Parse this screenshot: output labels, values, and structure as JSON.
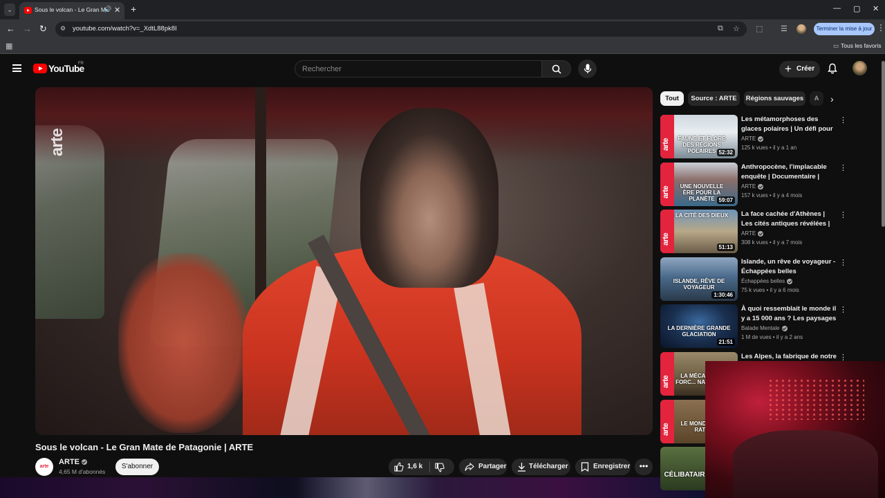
{
  "browser": {
    "tab_title": "Sous le volcan - Le Gran Ma",
    "url": "youtube.com/watch?v=_XdtL88pk8I",
    "update_button": "Terminer la mise à jour",
    "bookmarks_all": "Tous les favoris"
  },
  "header": {
    "logo_text": "YouTube",
    "country": "FR",
    "search_placeholder": "Rechercher",
    "create_label": "Créer"
  },
  "video": {
    "title": "Sous le volcan - Le Gran Mate de Patagonie | ARTE",
    "watermark": "arte",
    "channel": {
      "name": "ARTE",
      "avatar_text": "arte",
      "subscribers": "4,65 M d'abonnés",
      "subscribe_label": "S'abonner"
    },
    "actions": {
      "likes": "1,6 k",
      "share": "Partager",
      "download": "Télécharger",
      "save": "Enregistrer"
    }
  },
  "chips": [
    "Tout",
    "Source : ARTE",
    "Régions sauvages",
    "A"
  ],
  "recommendations": [
    {
      "title": "Les métamorphoses des glaces polaires | Un défi pour les ...",
      "channel": "ARTE",
      "views": "125 k vues",
      "age": "il y a 1 an",
      "duration": "52:32",
      "caption": "FAUNE ET FLORE DES RÉGIONS POLAIRES",
      "arte_band": "arte"
    },
    {
      "title": "Anthropocène, l'implacable enquête | Documentaire | ARTE",
      "channel": "ARTE",
      "views": "157 k vues",
      "age": "il y a 4 mois",
      "duration": "59:07",
      "caption": "UNE NOUVELLE ÈRE POUR LA PLANÈTE",
      "arte_band": "arte"
    },
    {
      "title": "La face cachée d'Athènes | Les cités antiques révélées | ARTE",
      "channel": "ARTE",
      "views": "308 k vues",
      "age": "il y a 7 mois",
      "duration": "51:13",
      "caption": "LA CITÉ DES DIEUX",
      "arte_band": "arte"
    },
    {
      "title": "Islande, un rêve de voyageur - Échappées belles",
      "channel": "Échappées belles",
      "views": "75 k vues",
      "age": "il y a 6 mois",
      "duration": "1:30:46",
      "caption": "ISLANDE, RÊVE DE VOYAGEUR",
      "arte_band": ""
    },
    {
      "title": "À quoi ressemblait le monde il y a 15 000 ans ? Les paysages ...",
      "channel": "Balade Mentale",
      "views": "1 M de vues",
      "age": "il y a 2 ans",
      "duration": "21:51",
      "caption": "LA DERNIÈRE GRANDE GLACIATION",
      "arte_band": ""
    },
    {
      "title": "Les Alpes, la fabrique de notre",
      "channel": "",
      "views": "",
      "age": "",
      "duration": "",
      "caption": "LA MÉCA... DES FORC... NATUREL...",
      "arte_band": "arte"
    },
    {
      "title": "",
      "channel": "",
      "views": "",
      "age": "",
      "duration": "",
      "caption": "LE MONDE DES RATS",
      "arte_band": "arte"
    },
    {
      "title": "",
      "channel": "",
      "views": "",
      "age": "",
      "duration": "",
      "caption": "CÉLIBATAIR",
      "arte_band": ""
    }
  ],
  "colors": {
    "youtube_red": "#ff0000",
    "arte_red": "#e4233d",
    "bg": "#0f0f0f",
    "update_button": "#a8c7fa"
  }
}
